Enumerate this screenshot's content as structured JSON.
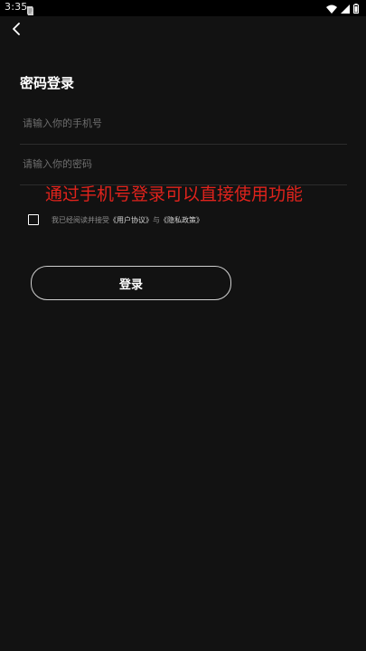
{
  "status_bar": {
    "time": "3:35",
    "icons": [
      "app-notification-icon",
      "wifi-icon",
      "signal-icon",
      "battery-icon"
    ]
  },
  "nav": {
    "back_icon": "chevron-left-icon"
  },
  "page": {
    "title": "密码登录"
  },
  "form": {
    "phone_placeholder": "请输入你的手机号",
    "phone_value": "",
    "password_placeholder": "请输入你的密码",
    "password_value": ""
  },
  "overlay": {
    "caption": "通过手机号登录可以直接使用功能",
    "color": "#e0231c"
  },
  "agreement": {
    "checked": false,
    "prefix": "我已经阅读并接受",
    "user_agreement": "《用户协议》",
    "conjunction": "与",
    "privacy_policy": "《隐私政策》"
  },
  "login": {
    "label": "登录"
  },
  "colors": {
    "background": "#121212",
    "status_bar": "#000000",
    "text": "#ffffff",
    "placeholder": "#6e6e6e",
    "divider": "#2c2c2c",
    "accent_caption": "#e0231c"
  }
}
